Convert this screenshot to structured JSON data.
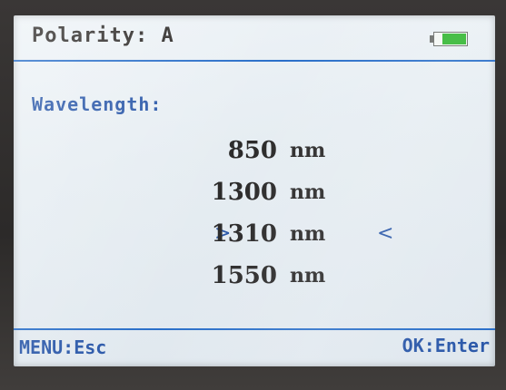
{
  "header": {
    "title": "Polarity: A",
    "battery_icon": "battery-icon",
    "battery_level": 0.75,
    "battery_color": "#2fb52f"
  },
  "section_label": "Wavelength:",
  "options": [
    {
      "value": "850",
      "unit": "nm",
      "selected": false
    },
    {
      "value": "1300",
      "unit": "nm",
      "selected": false
    },
    {
      "value": "1310",
      "unit": "nm",
      "selected": true
    },
    {
      "value": "1550",
      "unit": "nm",
      "selected": false
    }
  ],
  "selection_markers": {
    "left": ">",
    "right": "<"
  },
  "footer": {
    "left": "MENU:Esc",
    "right": "OK:Enter"
  },
  "colors": {
    "accent": "#2856a8",
    "divider": "#2a6fc9",
    "text": "#2b2a2a",
    "screen_bg": "#e6edf2"
  }
}
